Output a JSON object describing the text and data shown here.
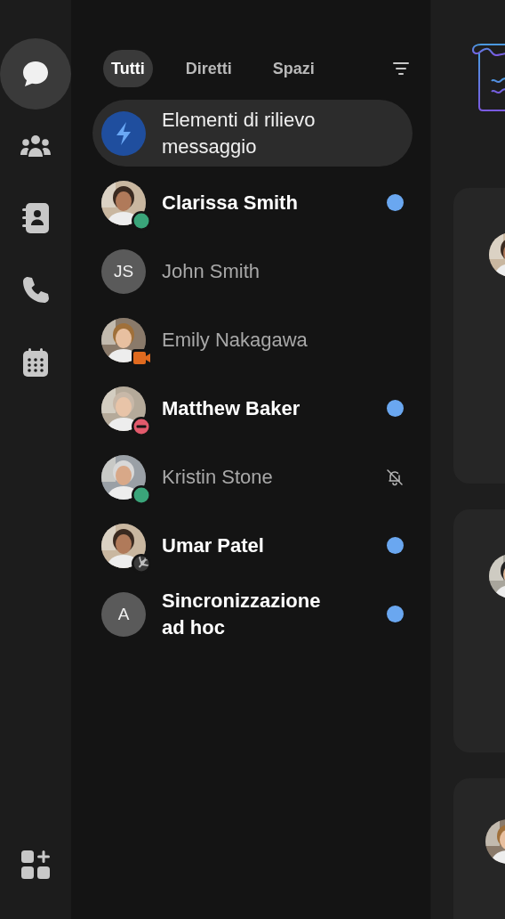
{
  "rail": {
    "items": [
      {
        "kind": "chat",
        "selected": true
      },
      {
        "kind": "teams",
        "selected": false
      },
      {
        "kind": "contacts",
        "selected": false
      },
      {
        "kind": "calls",
        "selected": false
      },
      {
        "kind": "calendar",
        "selected": false
      }
    ],
    "bottom": {
      "kind": "apps"
    }
  },
  "tabs": [
    {
      "label": "Tutti",
      "selected": true
    },
    {
      "label": "Diretti",
      "selected": false
    },
    {
      "label": "Spazi",
      "selected": false
    }
  ],
  "highlights": {
    "label": "Elementi di rilievo messaggio"
  },
  "conversations": [
    {
      "name": "Clarissa Smith",
      "status": {
        "kind": "available"
      },
      "unread": true,
      "muted": false
    },
    {
      "name": "John Smith",
      "kind": "initials",
      "initials": "JS",
      "unread": false,
      "muted": false
    },
    {
      "name": "Emily Nakagawa",
      "status": {
        "kind": "meeting"
      },
      "unread": false,
      "muted": false
    },
    {
      "name": "Matthew Baker",
      "status": {
        "kind": "dnd"
      },
      "unread": true,
      "muted": false
    },
    {
      "name": "Kristin Stone",
      "status": {
        "kind": "available"
      },
      "unread": false,
      "muted": true
    },
    {
      "name": "Umar Patel",
      "status": {
        "kind": "travel"
      },
      "unread": true,
      "muted": false
    },
    {
      "name": "Sincronizzazione ad hoc",
      "kind": "initials",
      "initials": "A",
      "unread": true,
      "muted": false
    }
  ]
}
